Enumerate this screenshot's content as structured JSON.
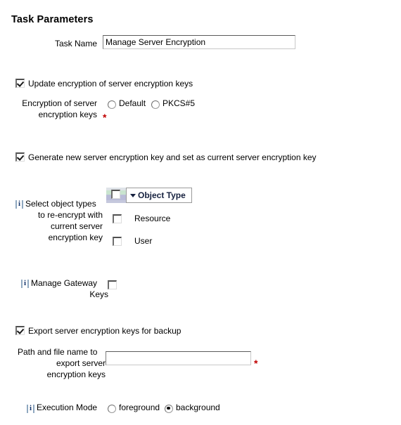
{
  "page": {
    "title": "Task Parameters"
  },
  "task_name": {
    "label": "Task Name",
    "value": "Manage Server Encryption",
    "placeholder": ""
  },
  "update_encryption": {
    "checkbox_label": "Update encryption of server encryption keys",
    "checked": true
  },
  "encryption_method": {
    "label_line1": "Encryption of server",
    "label_line2": "encryption keys",
    "required_marker": "*",
    "options": [
      {
        "label": "Default",
        "selected": false
      },
      {
        "label": "PKCS#5",
        "selected": false
      }
    ]
  },
  "generate_key": {
    "checkbox_label": "Generate new server encryption key and set as current server encryption key",
    "checked": true
  },
  "object_types": {
    "label_line1": "Select object types",
    "label_line2": "to re-encrypt with",
    "label_line3": "current server",
    "label_line4": "encryption key",
    "info_icon": "info-icon",
    "header": {
      "select_all_checked": false,
      "sort_icon": "chevron-down-icon",
      "column_label": "Object Type"
    },
    "rows": [
      {
        "label": "Resource",
        "checked": false
      },
      {
        "label": "User",
        "checked": false
      }
    ]
  },
  "gateway_keys": {
    "info_icon": "info-icon",
    "label_line1": "Manage Gateway",
    "label_line2": "Keys",
    "checked": false
  },
  "export_keys": {
    "checkbox_label": "Export server encryption keys for backup",
    "checked": true
  },
  "export_path": {
    "label_line1": "Path and file name to",
    "label_line2": "export server",
    "label_line3": "encryption keys",
    "value": "",
    "placeholder": "",
    "required_marker": "*"
  },
  "execution_mode": {
    "info_icon": "info-icon",
    "label": "Execution Mode",
    "options": [
      {
        "label": "foreground",
        "selected": false
      },
      {
        "label": "background",
        "selected": true
      }
    ]
  },
  "colors": {
    "required": "#c00000",
    "header_label": "#16213f",
    "input_border": "#5a5a5a",
    "background": "#ffffff"
  }
}
